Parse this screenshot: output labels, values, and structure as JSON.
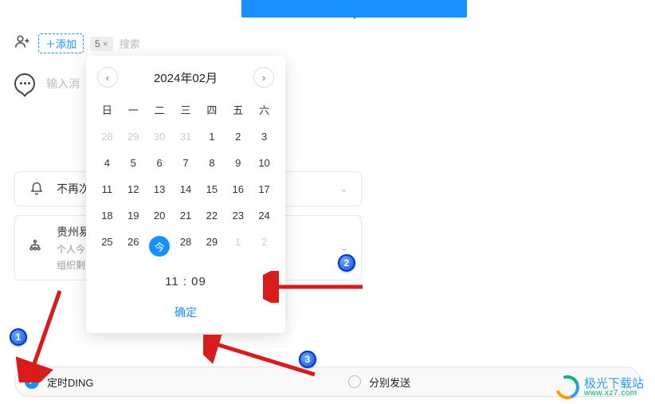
{
  "top": {
    "add": "＋添加",
    "count": "5",
    "count_x": "×",
    "search_ph": "搜索"
  },
  "msg": {
    "placeholder": "输入消"
  },
  "mute": {
    "title": "不再次"
  },
  "org": {
    "title": "贵州易",
    "sub1": "个人今天",
    "sub2": "组织剩余"
  },
  "picker": {
    "title": "2024年02月",
    "weekdays": [
      "日",
      "一",
      "二",
      "三",
      "四",
      "五",
      "六"
    ],
    "grid": [
      {
        "n": "28",
        "dim": true
      },
      {
        "n": "29",
        "dim": true
      },
      {
        "n": "30",
        "dim": true
      },
      {
        "n": "31",
        "dim": true
      },
      {
        "n": "1"
      },
      {
        "n": "2"
      },
      {
        "n": "3"
      },
      {
        "n": "4"
      },
      {
        "n": "5"
      },
      {
        "n": "6"
      },
      {
        "n": "7"
      },
      {
        "n": "8"
      },
      {
        "n": "9"
      },
      {
        "n": "10"
      },
      {
        "n": "11"
      },
      {
        "n": "12"
      },
      {
        "n": "13"
      },
      {
        "n": "14"
      },
      {
        "n": "15"
      },
      {
        "n": "16"
      },
      {
        "n": "17"
      },
      {
        "n": "18"
      },
      {
        "n": "19"
      },
      {
        "n": "20"
      },
      {
        "n": "21"
      },
      {
        "n": "22"
      },
      {
        "n": "23"
      },
      {
        "n": "24"
      },
      {
        "n": "25"
      },
      {
        "n": "26"
      },
      {
        "n": "今",
        "today": true
      },
      {
        "n": "28"
      },
      {
        "n": "29"
      },
      {
        "n": "1",
        "dim": true
      },
      {
        "n": "2",
        "dim": true
      }
    ],
    "time": "11 : 09",
    "ok": "确定"
  },
  "bottom": {
    "scheduled": "定时DING",
    "split": "分别发送"
  },
  "badges": {
    "b1": "1",
    "b2": "2",
    "b3": "3"
  },
  "logo": {
    "cn": "极光下载站",
    "en": "www.xz7.com"
  }
}
